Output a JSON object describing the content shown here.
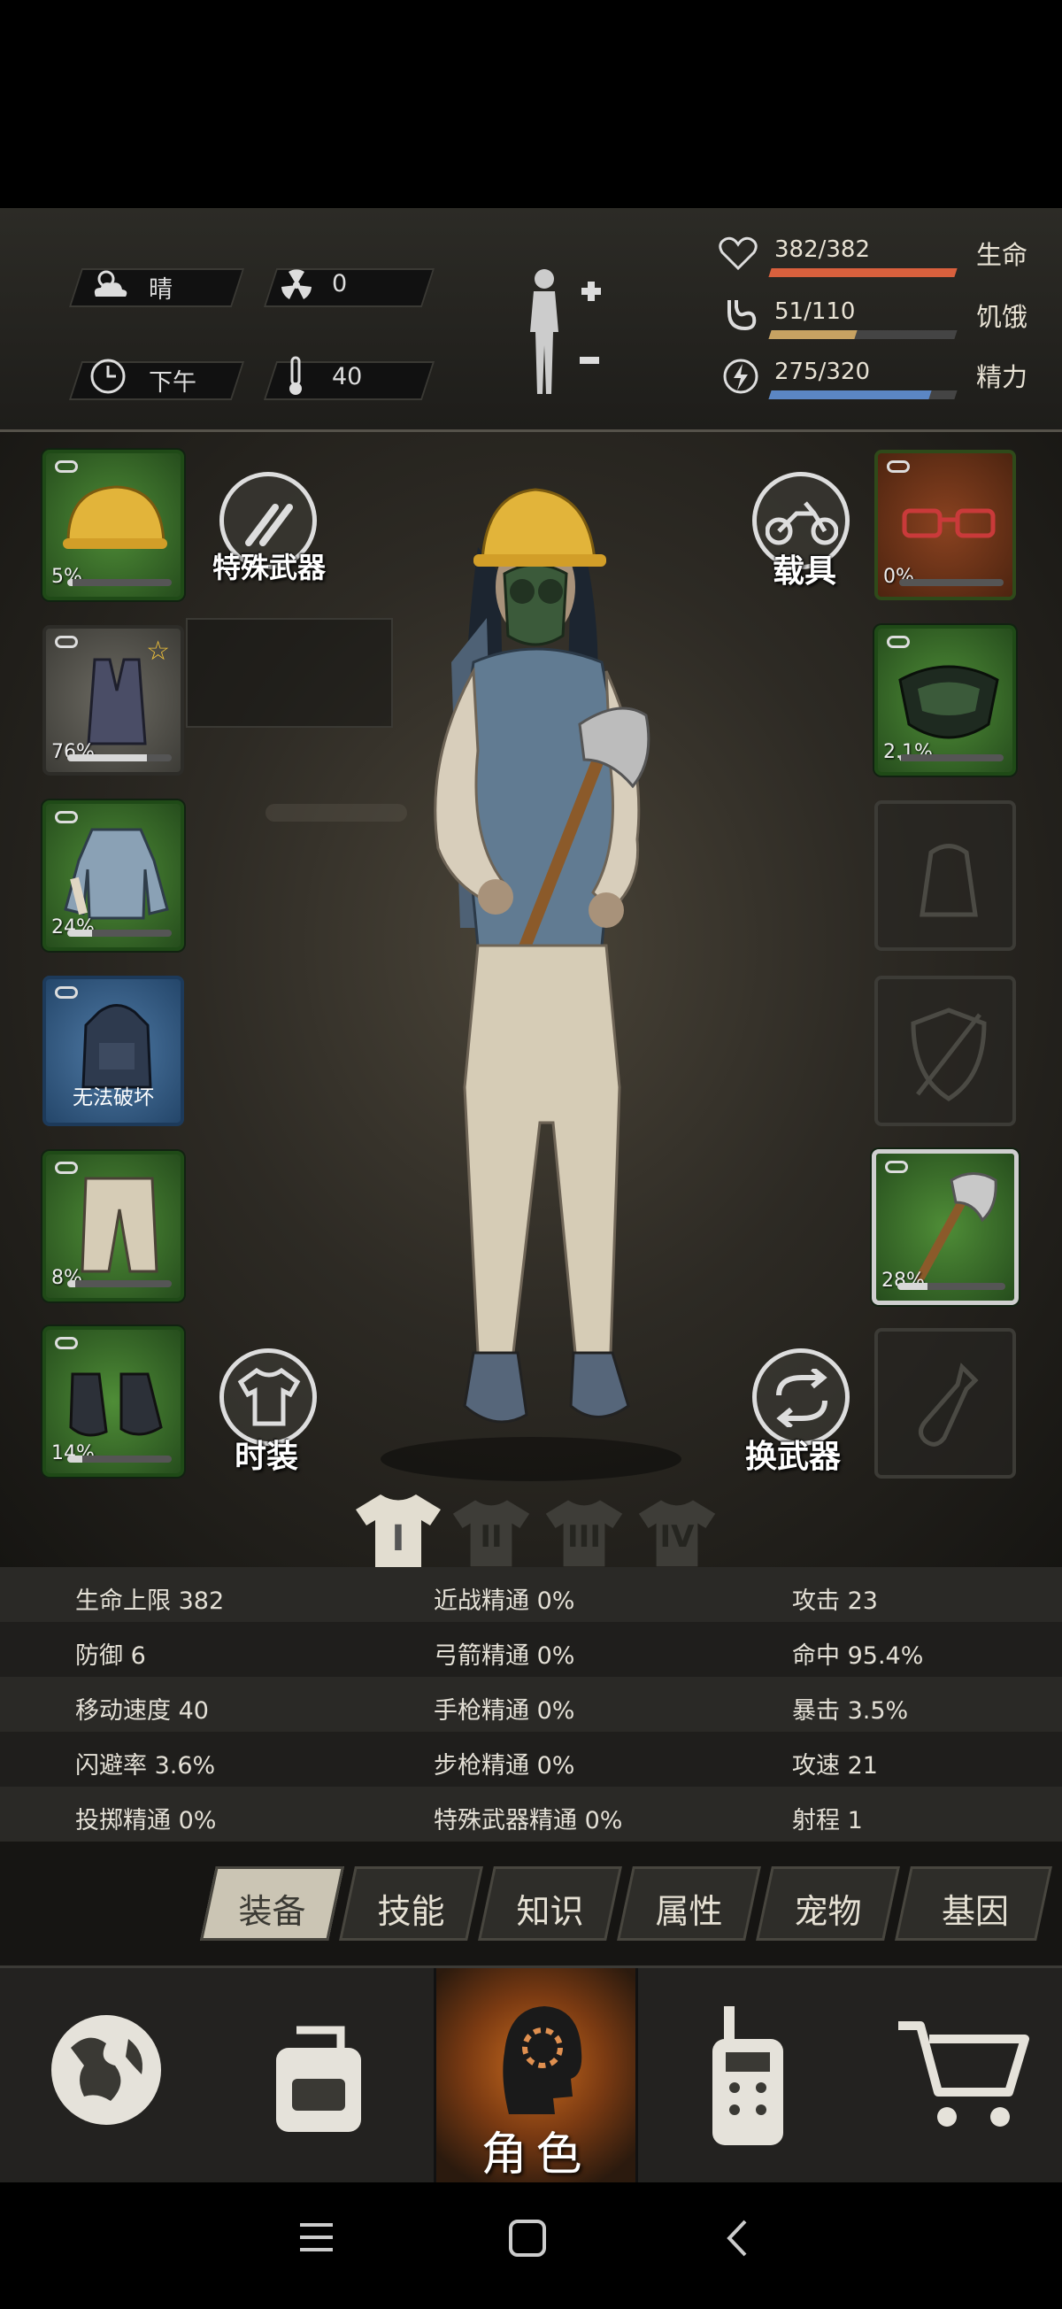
{
  "status": {
    "weather": "晴",
    "radiation": "0",
    "time_of_day": "下午",
    "temperature": "40",
    "health": {
      "text": "382/382",
      "label": "生命",
      "fraction": 1.0,
      "color": "#d9603d"
    },
    "hunger": {
      "text": "51/110",
      "label": "饥饿",
      "fraction": 0.46,
      "color": "#c7a262"
    },
    "energy": {
      "text": "275/320",
      "label": "精力",
      "fraction": 0.86,
      "color": "#5b86c4"
    }
  },
  "equipment": {
    "left": [
      {
        "name": "helmet",
        "pct": "5%",
        "fraction": 0.05,
        "rarity": "green"
      },
      {
        "name": "vest",
        "pct": "76%",
        "fraction": 0.76,
        "rarity": "gray",
        "starred": true
      },
      {
        "name": "jacket",
        "pct": "24%",
        "fraction": 0.24,
        "rarity": "green"
      },
      {
        "name": "backpack",
        "pct": "无法破坏",
        "rarity": "blue"
      },
      {
        "name": "pants",
        "pct": "8%",
        "fraction": 0.08,
        "rarity": "green"
      },
      {
        "name": "shoes",
        "pct": "14%",
        "fraction": 0.14,
        "rarity": "green"
      }
    ],
    "right": [
      {
        "name": "glasses",
        "pct": "0%",
        "fraction": 0.0,
        "rarity": "brown"
      },
      {
        "name": "gas-mask",
        "pct": "2.1%",
        "fraction": 0.021,
        "rarity": "green"
      },
      {
        "name": "empty-bag",
        "rarity": "empty"
      },
      {
        "name": "empty-shield",
        "rarity": "empty"
      },
      {
        "name": "axe",
        "pct": "28%",
        "fraction": 0.28,
        "rarity": "green",
        "selected": true
      },
      {
        "name": "empty-bottle",
        "rarity": "empty"
      }
    ]
  },
  "buttons": {
    "special_weapon": "特殊武器",
    "vehicle": "载具",
    "fashion": "时装",
    "swap_weapon": "换武器"
  },
  "outfit_sets": [
    "I",
    "II",
    "III",
    "IV"
  ],
  "stats": [
    [
      "生命上限 382",
      "近战精通 0%",
      "攻击 23"
    ],
    [
      "防御 6",
      "弓箭精通 0%",
      "命中 95.4%"
    ],
    [
      "移动速度 40",
      "手枪精通 0%",
      "暴击 3.5%"
    ],
    [
      "闪避率 3.6%",
      "步枪精通 0%",
      "攻速 21"
    ],
    [
      "投掷精通 0%",
      "特殊武器精通 0%",
      "射程 1"
    ]
  ],
  "tabs": [
    "装备",
    "技能",
    "知识",
    "属性",
    "宠物",
    "基因"
  ],
  "nav": {
    "character": "角色"
  }
}
